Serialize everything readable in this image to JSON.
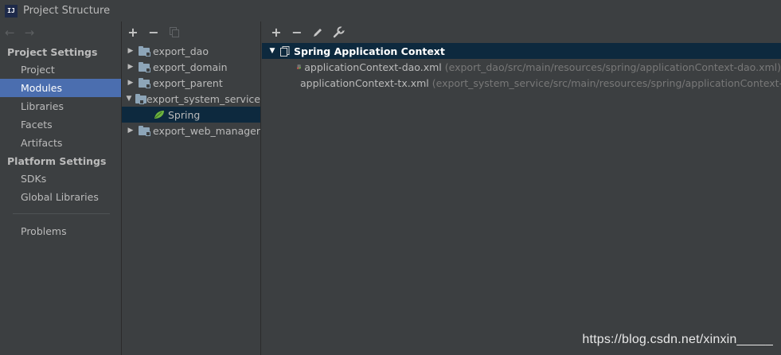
{
  "window": {
    "title": "Project Structure",
    "app_icon_text": "IJ"
  },
  "nav": {
    "back_icon": "arrow-left-icon",
    "forward_icon": "arrow-right-icon",
    "sections": [
      {
        "label": "Project Settings",
        "items": [
          "Project",
          "Modules",
          "Libraries",
          "Facets",
          "Artifacts"
        ]
      },
      {
        "label": "Platform Settings",
        "items": [
          "SDKs",
          "Global Libraries"
        ]
      }
    ],
    "selected": "Modules",
    "problems": "Problems"
  },
  "module_toolbar": {
    "add": "+",
    "remove": "−",
    "copy_icon": "copy-icon"
  },
  "modules": [
    {
      "name": "export_dao",
      "expanded": false
    },
    {
      "name": "export_domain",
      "expanded": false
    },
    {
      "name": "export_parent",
      "expanded": false
    },
    {
      "name": "export_system_service",
      "expanded": true
    },
    {
      "name": "Spring",
      "child": true,
      "selected": true
    },
    {
      "name": "export_web_manager",
      "expanded": false
    }
  ],
  "content_toolbar": {
    "add": "+",
    "remove": "−",
    "edit_icon": "pencil-icon",
    "settings_icon": "wrench-icon"
  },
  "context": {
    "label": "Spring Application Context",
    "files": [
      {
        "name": "applicationContext-dao.xml",
        "path": "(export_dao/src/main/resources/spring/applicationContext-dao.xml)"
      },
      {
        "name": "applicationContext-tx.xml",
        "path": "(export_system_service/src/main/resources/spring/applicationContext-tx.xml)"
      }
    ]
  },
  "watermark": "https://blog.csdn.net/xinxin_____",
  "colors": {
    "background": "#3c3f41",
    "selection": "#4b6eaf",
    "tree_selection": "#0d293e",
    "spring_green": "#6db33f"
  }
}
